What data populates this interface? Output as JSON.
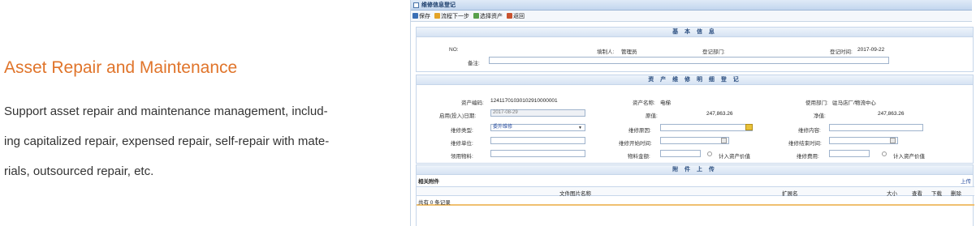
{
  "promo": {
    "title": "Asset Repair and Maintenance",
    "desc_lines": [
      "Support asset repair and maintenance management, includ-",
      "ing capitalized repair, expensed repair, self-repair with mate-",
      "rials, outsourced repair, etc."
    ]
  },
  "window": {
    "title": "维修信息登记"
  },
  "toolbar": {
    "save": "保存",
    "flow_next": "流程下一步",
    "select_asset": "选择资产",
    "back": "返回"
  },
  "basic": {
    "header": "基 本 信 息",
    "no_label": "NO:",
    "maker_label": "填制人:",
    "maker_value": "管理员",
    "dept_label": "登记部门:",
    "date_label": "登记时间:",
    "date_value": "2017-09-22",
    "remark_label": "备注:"
  },
  "detail": {
    "header": "资 产 维 修 明 细 登 记",
    "asset_code_label": "资产编码:",
    "asset_code_value": "12411701030102910000001",
    "asset_name_label": "资产名称:",
    "asset_name_value": "电梯",
    "use_dept_label": "使用部门:",
    "use_dept_value": "驻马店厂/物流中心",
    "start_date_label": "启用(投入)日期:",
    "start_date_value": "2017-08-29",
    "orig_value_label": "原值:",
    "orig_value_value": "247,863.26",
    "net_value_label": "净值:",
    "net_value_value": "247,863.26",
    "repair_type_label": "维修类型:",
    "repair_type_value": "委外维修",
    "repair_reason_label": "维修原因:",
    "repair_content_label": "维修内容:",
    "repair_unit_label": "维修单位:",
    "repair_start_label": "维修开始时间:",
    "repair_end_label": "维修结束时间:",
    "material_label": "领用物料:",
    "material_amount_label": "物料金额:",
    "add_asset_value_1": "计入资产价值",
    "repair_fee_label": "维修费用:",
    "add_asset_value_2": "计入资产价值"
  },
  "attach": {
    "header": "附 件 上 传",
    "related_label": "相关附件",
    "upload_link": "上传",
    "col_filename": "文件图片名称",
    "col_ext": "扩展名",
    "col_size": "大小",
    "col_view": "查看",
    "col_download": "下载",
    "col_delete": "删除",
    "record_count": "共有 0 条记录"
  }
}
